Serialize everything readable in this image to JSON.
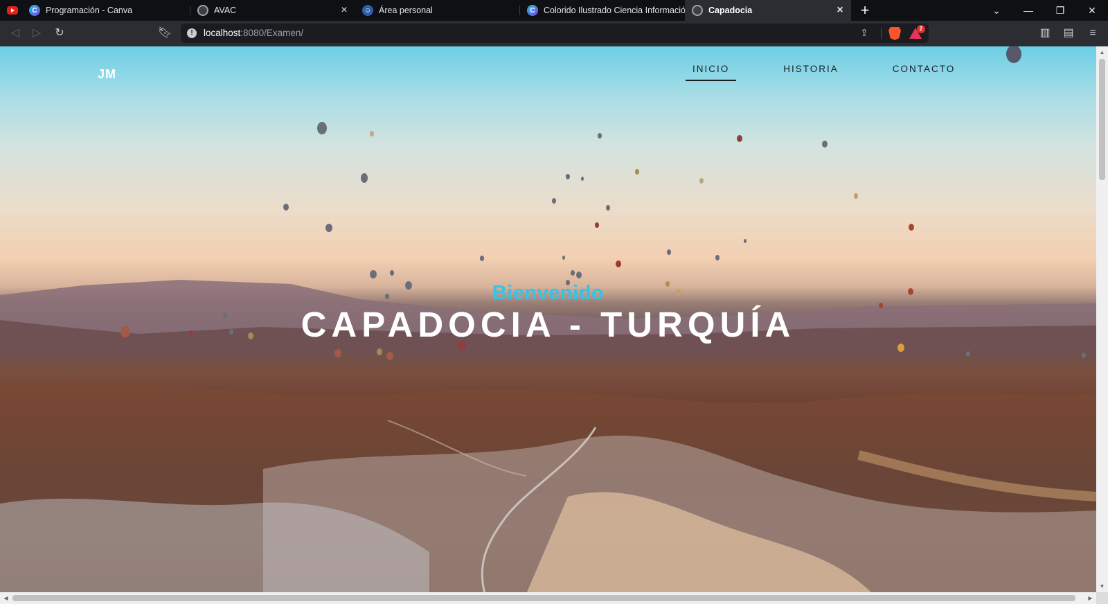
{
  "browser": {
    "tabs": [
      {
        "title": "Programación - Canva",
        "favicon": "youtube-icon",
        "active": false
      },
      {
        "title": "AVAC",
        "favicon": "globe-icon",
        "active": false
      },
      {
        "title": "Área personal",
        "favicon": "person-icon",
        "active": false
      },
      {
        "title": "Colorido Ilustrado Ciencia Información",
        "favicon": "canva-icon",
        "active": false
      },
      {
        "title": "Capadocia",
        "favicon": "globe-icon",
        "active": true
      }
    ],
    "url_host": "localhost",
    "url_path": ":8080/Examen/",
    "rewards_badge": "2"
  },
  "site": {
    "logo": "JM",
    "nav": [
      {
        "label": "INICIO",
        "active": true
      },
      {
        "label": "HISTORIA",
        "active": false
      },
      {
        "label": "CONTACTO",
        "active": false
      }
    ],
    "hero": {
      "subtitle": "Bienvenido",
      "title": "CAPADOCIA - TURQUÍA"
    }
  },
  "colors": {
    "accent": "#35c3e8",
    "nav_text": "#1a1d22",
    "title_text": "#ffffff"
  }
}
